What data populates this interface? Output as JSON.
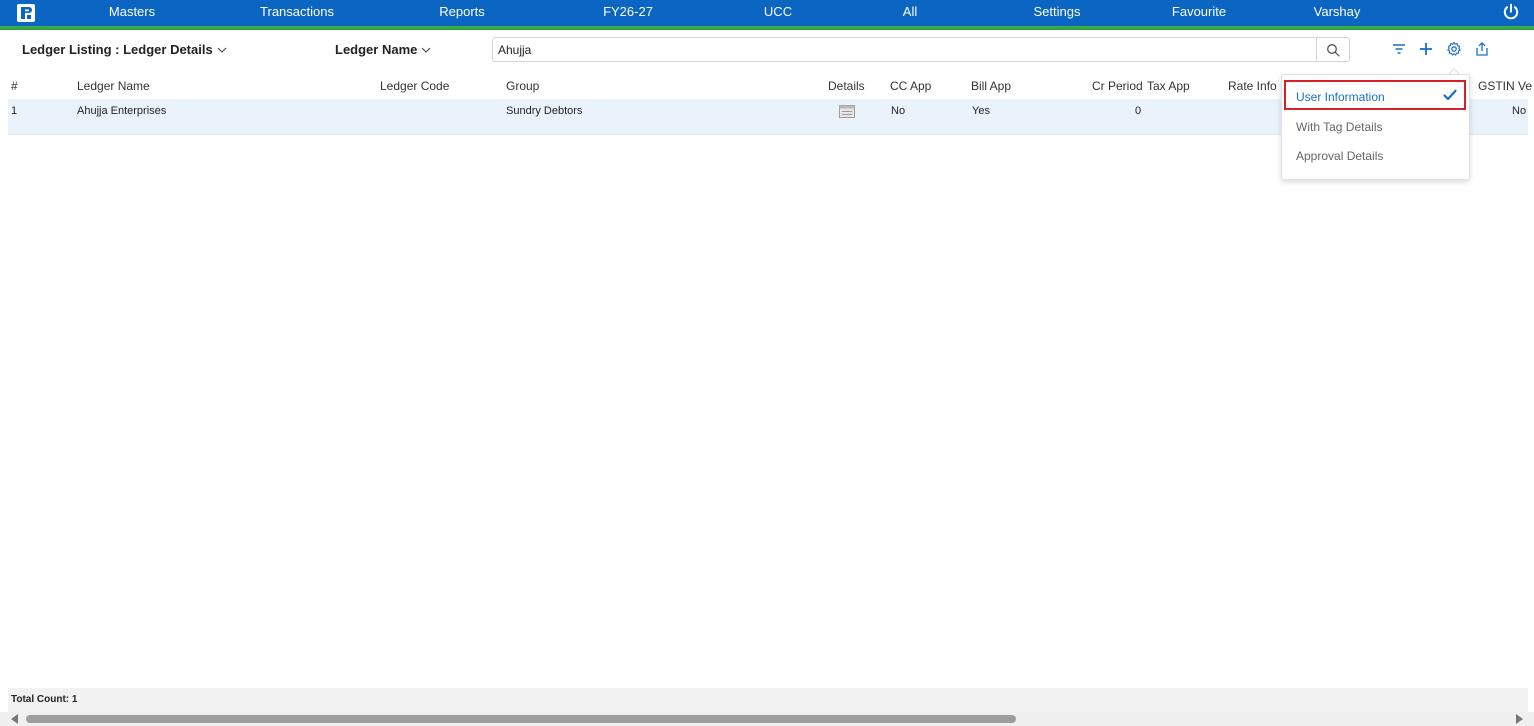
{
  "topbar": {
    "logo_icon": "company-logo",
    "menu": [
      {
        "label": "Masters"
      },
      {
        "label": "Transactions"
      },
      {
        "label": "Reports"
      },
      {
        "label": "FY26-27"
      },
      {
        "label": "UCC"
      },
      {
        "label": "All"
      },
      {
        "label": "Settings"
      },
      {
        "label": "Favourite"
      },
      {
        "label": "Varshay"
      }
    ],
    "power_icon": "power-icon",
    "bg_color": "#0a66c2",
    "accent_color": "#3db24b"
  },
  "header": {
    "listing_title": "Ledger Listing : Ledger Details",
    "search_field_label": "Ledger Name",
    "search_value": "Ahujja",
    "icons": [
      "filter-icon",
      "add-icon",
      "settings-icon",
      "export-icon"
    ]
  },
  "table": {
    "columns": [
      "#",
      "Ledger Name",
      "Ledger Code",
      "Group",
      "Details",
      "CC App",
      "Bill App",
      "Cr Period",
      "Tax App",
      "Rate Info",
      "GSTIN Ve"
    ],
    "rows": [
      {
        "index": "1",
        "ledger_name": "Ahujja Enterprises",
        "ledger_code": "",
        "group": "Sundry Debtors",
        "details": "details-icon",
        "cc_app": "No",
        "bill_app": "Yes",
        "cr_period": "0",
        "tax_app": "",
        "rate_info": "",
        "gstin_ve": "No"
      }
    ]
  },
  "settings_menu": {
    "items": [
      {
        "label": "User Information",
        "selected": true
      },
      {
        "label": "With Tag Details",
        "selected": false
      },
      {
        "label": "Approval Details",
        "selected": false
      }
    ],
    "selected_color": "#1a6fc4",
    "highlight_color": "#d42027"
  },
  "footer": {
    "total_count": "Total Count: 1"
  }
}
